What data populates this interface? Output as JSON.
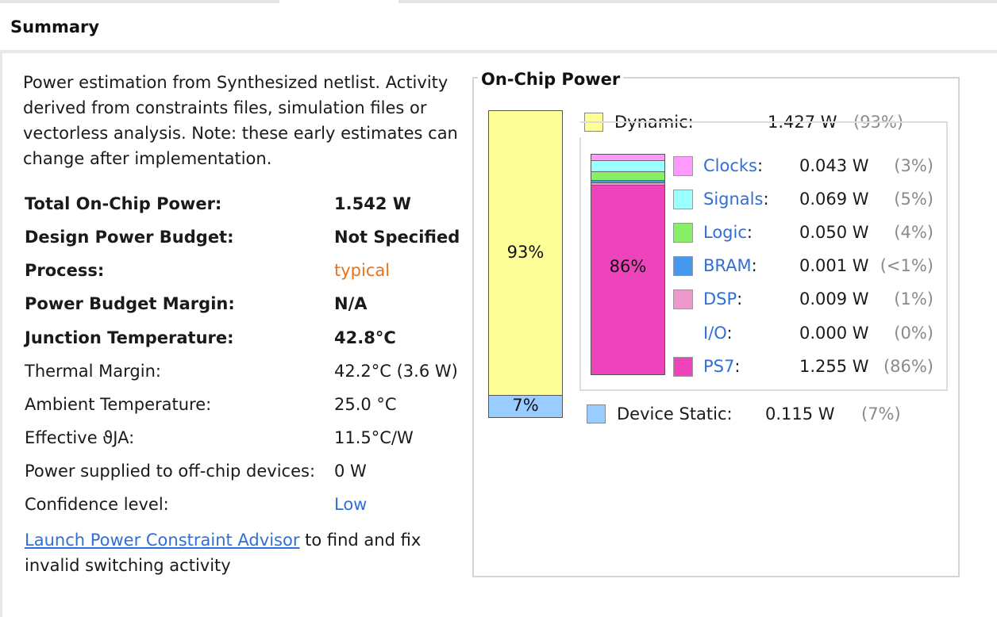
{
  "header": {
    "title": "Summary"
  },
  "description": "Power estimation from Synthesized netlist. Activity derived from constraints files, simulation files or vectorless analysis. Note: these early estimates can change after implementation.",
  "rows": [
    {
      "label": "Total On-Chip Power:",
      "value": "1.542 W"
    },
    {
      "label": "Design Power Budget:",
      "value": "Not Specified"
    },
    {
      "label": "Process:",
      "value": "typical"
    },
    {
      "label": "Power Budget Margin:",
      "value": "N/A"
    },
    {
      "label": "Junction Temperature:",
      "value": "42.8°C"
    },
    {
      "label": "Thermal Margin:",
      "value": "42.2°C (3.6 W)"
    },
    {
      "label": "Ambient Temperature:",
      "value": "25.0 °C"
    },
    {
      "label": "Effective ϑJA:",
      "value": "11.5°C/W"
    },
    {
      "label": "Power supplied to off-chip devices:",
      "value": "0 W"
    },
    {
      "label": "Confidence level:",
      "value": "Low"
    }
  ],
  "advisor": {
    "link": "Launch Power Constraint Advisor",
    "text": " to find and fix invalid switching activity"
  },
  "panel": {
    "title": "On-Chip Power",
    "dynamic": {
      "label": "Dynamic:",
      "value": "1.427 W",
      "pct": "(93%)",
      "bar_label": "93%",
      "fraction": 0.93,
      "color": "#ffff99"
    },
    "static": {
      "label": "Device Static:",
      "value": "0.115 W",
      "pct": "(7%)",
      "bar_label": "7%",
      "fraction": 0.07,
      "color": "#99ccff"
    },
    "ps7_bar_label": "86%",
    "components": [
      {
        "name": "Clocks",
        "sep": ":",
        "value": "0.043 W",
        "pct": "(3%)",
        "fraction": 0.03,
        "color": "#ff99ff"
      },
      {
        "name": "Signals",
        "sep": ":",
        "value": "0.069 W",
        "pct": "(5%)",
        "fraction": 0.05,
        "color": "#99ffff"
      },
      {
        "name": "Logic",
        "sep": ":",
        "value": "0.050 W",
        "pct": "(4%)",
        "fraction": 0.04,
        "color": "#88ee66"
      },
      {
        "name": "BRAM",
        "sep": ":",
        "value": "0.001 W",
        "pct": "(<1%)",
        "fraction": 0.01,
        "color": "#4499ee"
      },
      {
        "name": "DSP",
        "sep": ":",
        "value": "0.009 W",
        "pct": "(1%)",
        "fraction": 0.01,
        "color": "#ee99cc"
      },
      {
        "name": "I/O",
        "sep": ":",
        "value": "0.000 W",
        "pct": "(0%)",
        "fraction": 0.0,
        "color": ""
      },
      {
        "name": "PS7",
        "sep": ":",
        "value": "1.255 W",
        "pct": "(86%)",
        "fraction": 0.86,
        "color": "#ee44bb"
      }
    ]
  }
}
